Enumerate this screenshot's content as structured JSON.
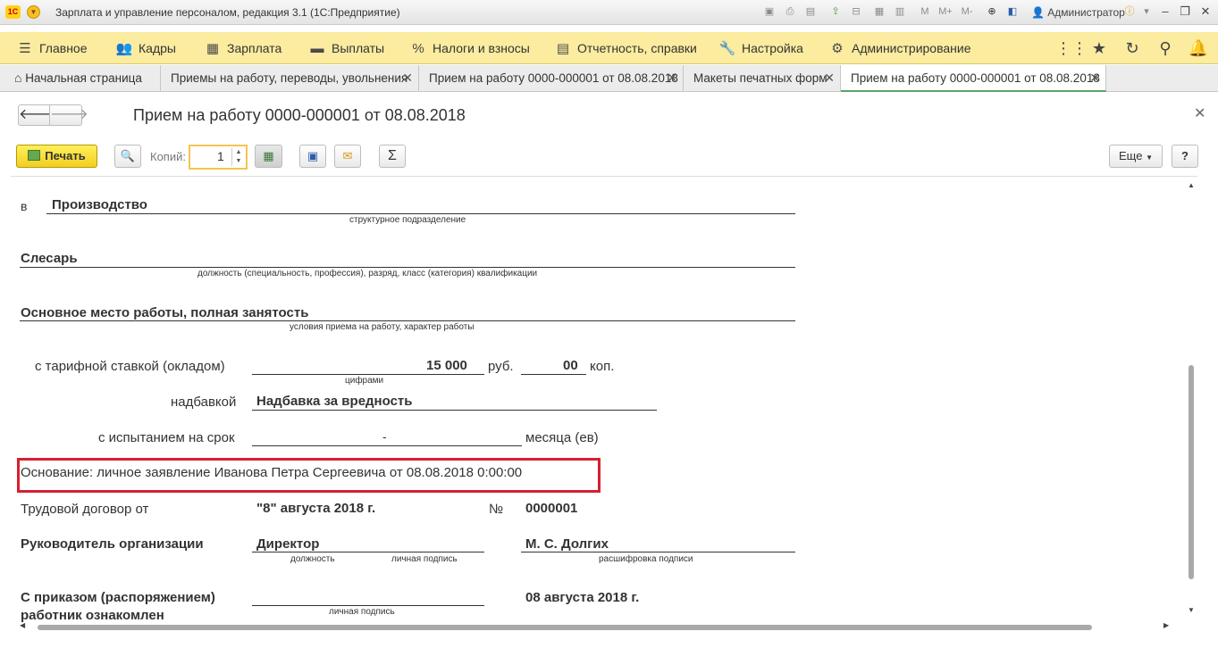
{
  "window": {
    "title": "Зарплата и управление персоналом, редакция 3.1 (1С:Предприятие)",
    "user": "Администратор",
    "toolbar_icons": [
      "save-icon",
      "print-icon",
      "preview-icon",
      "upload-icon",
      "link-icon",
      "calc-icon",
      "calendar-icon",
      "mem-m",
      "mem-mplus",
      "mem-mminus",
      "zoom-icon",
      "panel-icon"
    ]
  },
  "menu": {
    "items": [
      {
        "icon": "hamburger-icon",
        "label": "Главное"
      },
      {
        "icon": "people-icon",
        "label": "Кадры"
      },
      {
        "icon": "calculator-icon",
        "label": "Зарплата"
      },
      {
        "icon": "wallet-icon",
        "label": "Выплаты"
      },
      {
        "icon": "percent-icon",
        "label": "Налоги и взносы"
      },
      {
        "icon": "report-icon",
        "label": "Отчетность, справки"
      },
      {
        "icon": "wrench-icon",
        "label": "Настройка"
      },
      {
        "icon": "gear-icon",
        "label": "Администрирование"
      }
    ]
  },
  "tabs": [
    {
      "label": "Начальная страница"
    },
    {
      "label": "Приемы на работу, переводы, увольнения"
    },
    {
      "label": "Прием на работу 0000-000001 от 08.08.2018"
    },
    {
      "label": "Макеты печатных форм"
    },
    {
      "label": "Прием на работу 0000-000001 от 08.08.2018"
    }
  ],
  "form": {
    "title": "Прием на работу 0000-000001 от 08.08.2018",
    "print_label": "Печать",
    "copies_label": "Копий:",
    "copies_value": "1",
    "more_label": "Еще",
    "help_label": "?"
  },
  "document": {
    "dept_prefix": "в",
    "dept": "Производство",
    "dept_caption": "структурное подразделение",
    "position": "Слесарь",
    "position_caption": "должность (специальность, профессия), разряд, класс (категория) квалификации",
    "conditions": "Основное место работы, полная занятость",
    "conditions_caption": "условия приема на работу, характер работы",
    "rate_label": "с тарифной ставкой (окладом)",
    "rate_rub": "15 000",
    "rub": "руб.",
    "rate_kop": "00",
    "kop": "коп.",
    "rate_caption": "цифрами",
    "bonus_label": "надбавкой",
    "bonus": "Надбавка за вредность",
    "trial_label": "с испытанием на срок",
    "trial_value": "-",
    "trial_unit": "месяца (ев)",
    "basis": "Основание: личное заявление Иванова Петра Сергеевича от 08.08.2018 0:00:00",
    "contract_label": "Трудовой договор от",
    "contract_date": "\"8\" августа 2018 г.",
    "number_sign": "№",
    "contract_number": "0000001",
    "head_label": "Руководитель организации",
    "head_position": "Директор",
    "head_name": "М. С. Долгих",
    "cap_position": "должность",
    "cap_signature": "личная подпись",
    "cap_decode": "расшифровка подписи",
    "ack_line1": "С приказом (распоряжением)",
    "ack_line2": "работник ознакомлен",
    "ack_caption": "личная подпись",
    "ack_date": "08 августа 2018 г."
  }
}
